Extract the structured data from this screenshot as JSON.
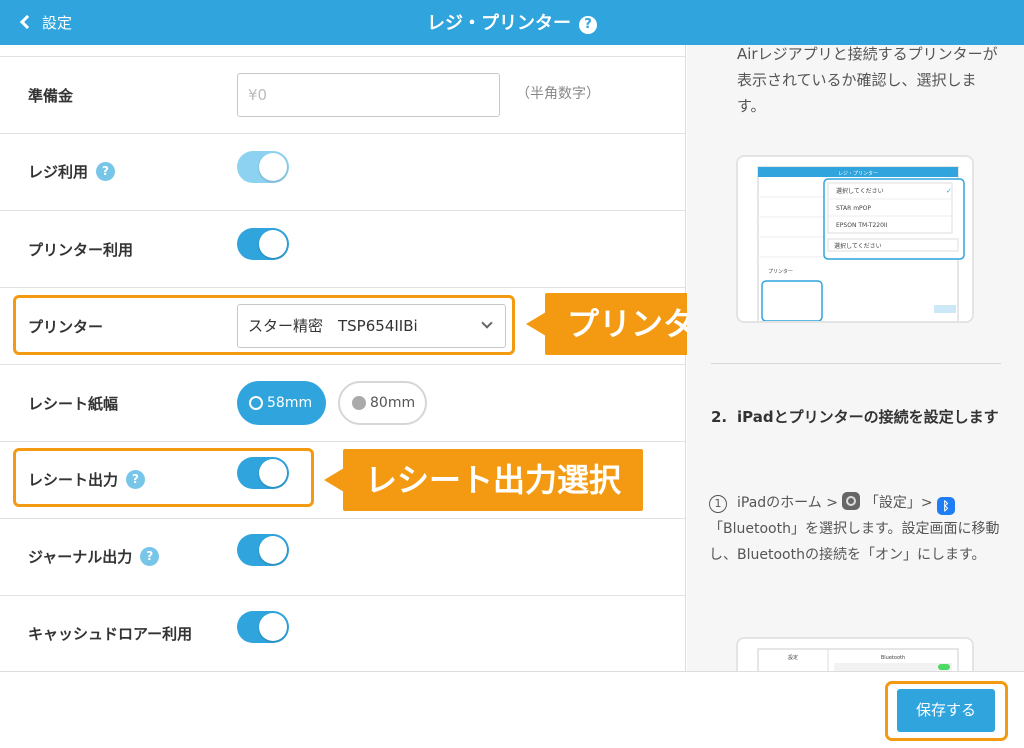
{
  "header": {
    "back_label": "設定",
    "title": "レジ・プリンター",
    "help": "?"
  },
  "rows": {
    "reserve": {
      "label": "準備金",
      "placeholder": "¥0",
      "hint": "（半角数字）"
    },
    "register_use": {
      "label": "レジ利用",
      "help": "?",
      "on": true
    },
    "printer_use": {
      "label": "プリンター利用",
      "on": true
    },
    "printer": {
      "label": "プリンター",
      "value": "スター精密　TSP654IIBi"
    },
    "receipt_width": {
      "label": "レシート紙幅",
      "options": [
        "58mm",
        "80mm"
      ],
      "selected": "58mm"
    },
    "receipt_output": {
      "label": "レシート出力",
      "help": "?",
      "on": true
    },
    "journal_output": {
      "label": "ジャーナル出力",
      "help": "?",
      "on": true
    },
    "cash_drawer": {
      "label": "キャッシュドロアー利用",
      "on": true
    }
  },
  "callouts": {
    "printer": "プリンター選択",
    "receipt": "レシート出力選択"
  },
  "help_panel": {
    "intro": "Airレジアプリと接続するプリンターが表示されているか確認し、選択します。",
    "mini_dropdown": {
      "title": "レジ・プリンター",
      "items": [
        "選択してください",
        "STAR mPOP",
        "EPSON TM-T220II"
      ],
      "select": "選択してください",
      "row_label": "プリンター"
    },
    "step2_number": "2.",
    "step2_title": "iPadとプリンターの接続を設定します",
    "sub_number": "1",
    "sub_text_1": "iPadのホーム >",
    "sub_text_2": "「設定」>",
    "sub_text_3": "「Bluetooth」を選択します。設定画面に移動し、Bluetoothの接続を「オン」にします。",
    "mini2_title": "Bluetooth",
    "mini2_left": "設定"
  },
  "footer": {
    "save_label": "保存する"
  },
  "colors": {
    "accent": "#2fa4dd",
    "highlight": "#f39a12"
  }
}
